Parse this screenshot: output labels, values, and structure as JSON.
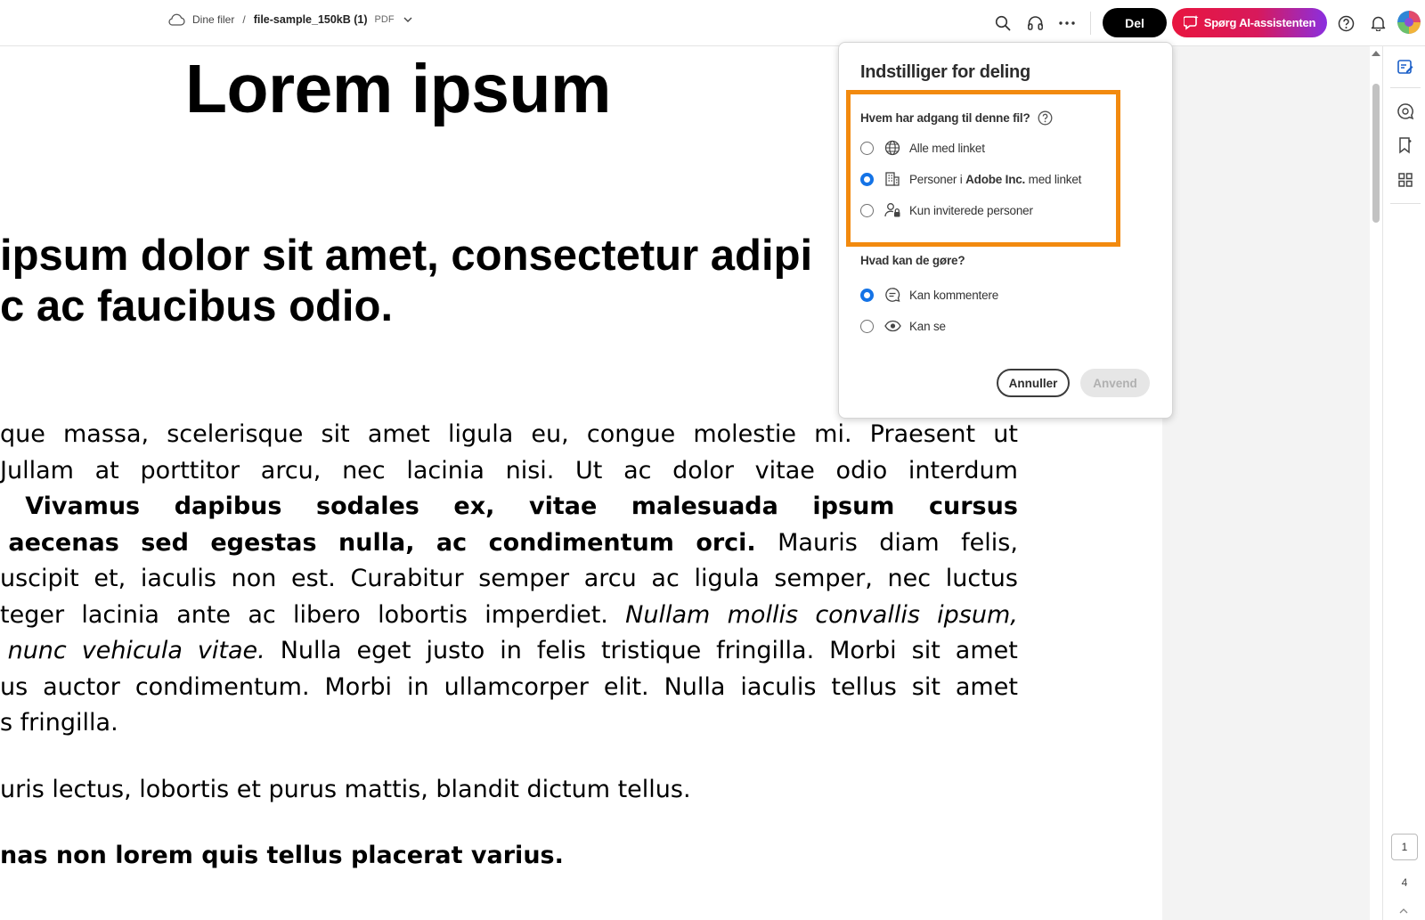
{
  "topbar": {
    "breadcrumb_root": "Dine filer",
    "breadcrumb_sep": "/",
    "file_name": "file-sample_150kB (1)",
    "file_type": "PDF",
    "share_label": "Del",
    "ai_label": "Spørg AI-assistenten",
    "icons": [
      "cloud-icon",
      "search-icon",
      "headphones-icon",
      "more-icon",
      "help-icon",
      "bell-icon",
      "avatar"
    ]
  },
  "document": {
    "title": "Lorem ipsum",
    "heading_line1": " ipsum dolor sit amet, consectetur adipi",
    "heading_line2": "c ac faucibus odio.",
    "paragraph_lines": [
      {
        "segments": [
          {
            "text": "que massa, scelerisque sit amet ligula eu, congue molestie mi. Praesent ut",
            "style": "normal"
          }
        ]
      },
      {
        "segments": [
          {
            "text": "Jullam at porttitor arcu, nec lacinia nisi. Ut ac dolor vitae odio interdum",
            "style": "normal"
          }
        ]
      },
      {
        "segments": [
          {
            "text": "   Vivamus dapibus sodales ex, vitae malesuada ipsum cursus",
            "style": "bold"
          }
        ]
      },
      {
        "segments": [
          {
            "text": "aecenas sed egestas nulla, ac condimentum orci.",
            "style": "bold"
          },
          {
            "text": " Mauris diam felis,",
            "style": "normal"
          }
        ]
      },
      {
        "segments": [
          {
            "text": "uscipit et, iaculis non est. Curabitur semper arcu ac ligula semper, nec luctus",
            "style": "normal"
          }
        ]
      },
      {
        "segments": [
          {
            "text": "teger lacinia ante ac libero lobortis imperdiet. ",
            "style": "normal"
          },
          {
            "text": "Nullam mollis convallis ipsum,",
            "style": "italic"
          }
        ]
      },
      {
        "segments": [
          {
            "text": "nunc vehicula vitae.",
            "style": "italic"
          },
          {
            "text": " Nulla eget justo in felis tristique fringilla. Morbi sit amet",
            "style": "normal"
          }
        ]
      },
      {
        "segments": [
          {
            "text": "us auctor condimentum. Morbi in ullamcorper elit. Nulla iaculis tellus sit amet",
            "style": "normal"
          }
        ]
      },
      {
        "segments": [
          {
            "text": "s fringilla.",
            "style": "normal"
          }
        ]
      }
    ],
    "line_after": "uris lectus, lobortis et purus mattis, blandit dictum tellus.",
    "bold_line": "nas non lorem quis tellus placerat varius."
  },
  "dialog": {
    "title": "Indstilliger for deling",
    "access_question": "Hvem har adgang til denne fil?",
    "access_options": [
      {
        "label": "Alle med linket",
        "selected": false,
        "icon": "globe-icon"
      },
      {
        "label_prefix": "Personer i ",
        "label_org": "Adobe Inc.",
        "label_suffix": " med linket",
        "selected": true,
        "icon": "building-icon"
      },
      {
        "label": "Kun inviterede personer",
        "selected": false,
        "icon": "person-lock-icon"
      }
    ],
    "permission_question": "Hvad kan de gøre?",
    "permission_options": [
      {
        "label": "Kan kommentere",
        "selected": true,
        "icon": "comment-icon"
      },
      {
        "label": "Kan se",
        "selected": false,
        "icon": "eye-icon"
      }
    ],
    "cancel_label": "Annuller",
    "apply_label": "Anvend",
    "highlight_color": "#f28a0f",
    "radio_color": "#1473e6"
  },
  "rail": {
    "current_page": "1",
    "total_pages": "4",
    "icons": [
      "edit-tools-icon",
      "ai-comment-icon",
      "bookmark-icon",
      "grid-icon"
    ]
  }
}
